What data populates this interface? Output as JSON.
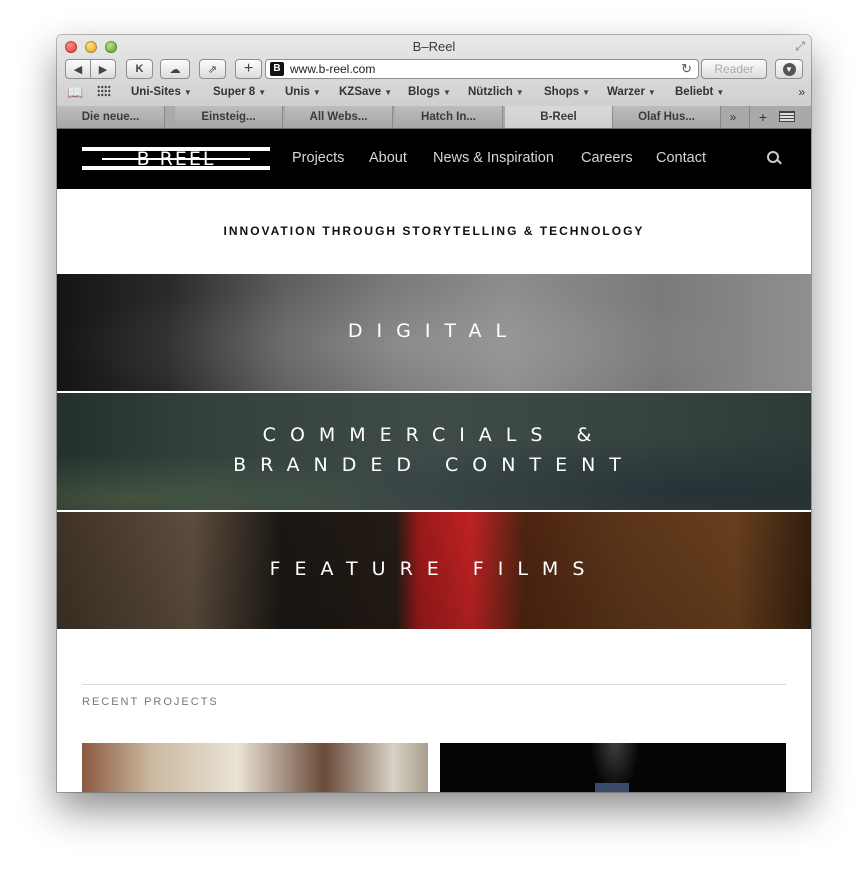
{
  "browser": {
    "window_title": "B–Reel",
    "url": "www.b-reel.com",
    "reader_label": "Reader",
    "bookmarks": [
      {
        "label": "Uni-Sites"
      },
      {
        "label": "Super 8"
      },
      {
        "label": "Unis"
      },
      {
        "label": "KZSave"
      },
      {
        "label": "Blogs"
      },
      {
        "label": "Nützlich"
      },
      {
        "label": "Shops"
      },
      {
        "label": "Warzer"
      },
      {
        "label": "Beliebt"
      }
    ],
    "tabs": [
      {
        "label": "Die neue..."
      },
      {
        "label": "Einsteig..."
      },
      {
        "label": "All Webs..."
      },
      {
        "label": "Hatch In..."
      },
      {
        "label": "B-Reel"
      },
      {
        "label": "Olaf Hus..."
      }
    ],
    "active_tab": "B-Reel"
  },
  "site": {
    "logo": "B REEL",
    "nav": [
      "Projects",
      "About",
      "News & Inspiration",
      "Careers",
      "Contact"
    ],
    "tagline": "INNOVATION THROUGH STORYTELLING & TECHNOLOGY",
    "banners": {
      "digital": "DIGITAL",
      "commercials_line1": "COMMERCIALS &",
      "commercials_line2": "BRANDED CONTENT",
      "feature": "FEATURE FILMS"
    },
    "recent_projects_label": "RECENT PROJECTS"
  },
  "colors": {
    "header_bg": "#000000",
    "nav_text": "#d6d6d6",
    "feature_red": "#e02828",
    "commercials_teal": "#3e4b49"
  }
}
